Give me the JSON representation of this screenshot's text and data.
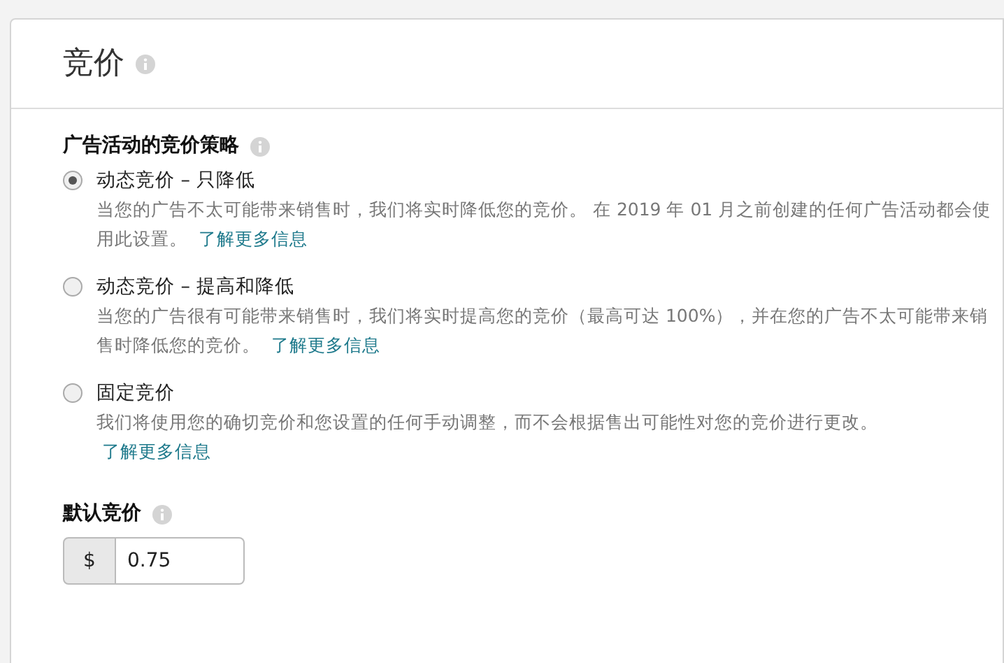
{
  "header": {
    "title": "竞价"
  },
  "strategy": {
    "label": "广告活动的竞价策略",
    "options": [
      {
        "label": "动态竞价 – 只降低",
        "description": "当您的广告不太可能带来销售时，我们将实时降低您的竞价。 在 2019 年 01 月之前创建的任何广告活动都会使用此设置。",
        "link": "了解更多信息",
        "selected": true
      },
      {
        "label": "动态竞价 – 提高和降低",
        "description": "当您的广告很有可能带来销售时，我们将实时提高您的竞价（最高可达 100%），并在您的广告不太可能带来销售时降低您的竞价。",
        "link": "了解更多信息",
        "selected": false
      },
      {
        "label": "固定竞价",
        "description": "我们将使用您的确切竞价和您设置的任何手动调整，而不会根据售出可能性对您的竞价进行更改。",
        "link": "了解更多信息",
        "selected": false
      }
    ]
  },
  "default_bid": {
    "label": "默认竞价",
    "prefix": "$",
    "value": "0.75"
  }
}
